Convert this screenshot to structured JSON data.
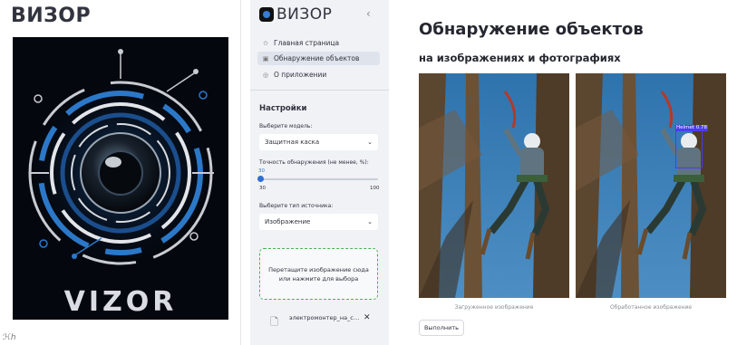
{
  "left_panel": {
    "title": "ВИЗОР",
    "poster_word": "VIZOR",
    "corner_mark": "ℋℎ"
  },
  "sidebar": {
    "brand": "ВИЗОР",
    "collapse_icon": "chevron-left-icon",
    "nav": [
      {
        "label": "Главная страница",
        "icon": "star-icon",
        "active": false
      },
      {
        "label": "Обнаружение объектов",
        "icon": "image-icon",
        "active": true
      },
      {
        "label": "О приложении",
        "icon": "info-icon",
        "active": false
      }
    ],
    "settings_title": "Настройки",
    "model_label": "Выберите модель:",
    "model_value": "Защитная каска",
    "confidence_label": "Точность обнаружения (не менее, %):",
    "confidence": {
      "value": 30,
      "min": 30,
      "max": 100
    },
    "confidence_value_text": "30",
    "confidence_min_text": "30",
    "confidence_max_text": "100",
    "source_label": "Выберите тип источника:",
    "source_value": "Изображение",
    "dropzone_line1": "Перетащите изображение сюда",
    "dropzone_line2": "или нажмите для выбора",
    "file_name": "электромонтер_на_с…",
    "remove_icon": "close-icon"
  },
  "main": {
    "title": "Обнаружение объектов",
    "subtitle": "на изображениях и фотографиях",
    "caption_uploaded": "Загруженное изображение",
    "caption_processed": "Обработанное изображение",
    "detection_label": "Helmet 0.78",
    "run_button": "Выполнить"
  },
  "colors": {
    "sidebar_bg": "#f0f2f6",
    "accent_blue": "#2f6fd3",
    "dropzone_border": "#4caf50",
    "detection_box": "#4b3cf2"
  }
}
